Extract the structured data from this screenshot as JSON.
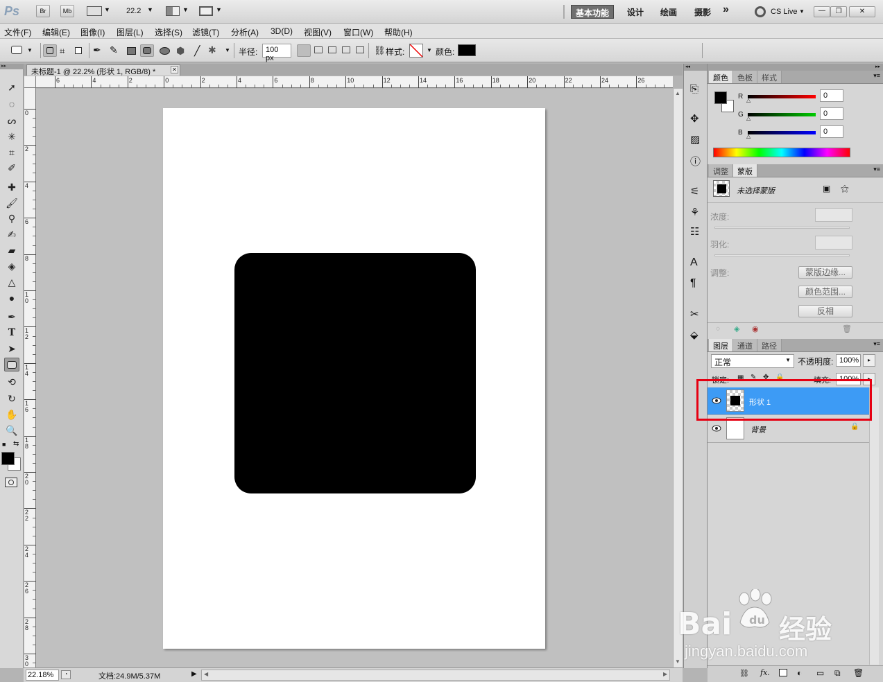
{
  "appbar": {
    "logo": "Ps",
    "br": "Br",
    "mb": "Mb",
    "zoom": "22.2",
    "workspaces": [
      "基本功能",
      "设计",
      "绘画",
      "摄影"
    ],
    "more": "»",
    "cslive": "CS Live",
    "min": "—",
    "restore": "❐",
    "close": "✕"
  },
  "menu": [
    "文件(F)",
    "编辑(E)",
    "图像(I)",
    "图层(L)",
    "选择(S)",
    "滤镜(T)",
    "分析(A)",
    "3D(D)",
    "视图(V)",
    "窗口(W)",
    "帮助(H)"
  ],
  "options": {
    "radius_label": "半径:",
    "radius_value": "100 px",
    "style_label": "样式:",
    "color_label": "颜色:",
    "color_value": "#000000"
  },
  "document": {
    "tab_title": "未标题-1 @ 22.2% (形状 1, RGB/8) *",
    "shape_color": "#000000",
    "hruler_ticks": [
      "6",
      "4",
      "2",
      "0",
      "2",
      "4",
      "6",
      "8",
      "10",
      "12",
      "14",
      "16",
      "18",
      "20",
      "22",
      "24",
      "26"
    ],
    "vruler_ticks": [
      "0",
      "2",
      "4",
      "6",
      "8",
      "10",
      "12",
      "14",
      "16",
      "18",
      "20",
      "22",
      "24",
      "26",
      "28",
      "30"
    ]
  },
  "status": {
    "zoom": "22.18%",
    "doc": "文档:24.9M/5.37M"
  },
  "color_panel": {
    "tabs": [
      "颜色",
      "色板",
      "样式"
    ],
    "channels": [
      {
        "name": "R",
        "value": "0"
      },
      {
        "name": "G",
        "value": "0"
      },
      {
        "name": "B",
        "value": "0"
      }
    ],
    "fg": "#000000",
    "bg": "#ffffff"
  },
  "mask_panel": {
    "tabs": [
      "调整",
      "蒙版"
    ],
    "title": "未选择蒙版",
    "density": "浓度:",
    "feather": "羽化:",
    "adjust": "调整:",
    "buttons": [
      "蒙版边缘...",
      "颜色范围...",
      "反相"
    ]
  },
  "layers_panel": {
    "tabs": [
      "图层",
      "通道",
      "路径"
    ],
    "blend_mode": "正常",
    "opacity_label": "不透明度:",
    "opacity_value": "100%",
    "lock_label": "锁定:",
    "fill_label": "填充:",
    "fill_value": "100%",
    "layers": [
      {
        "name": "形状 1",
        "selected": true
      },
      {
        "name": "背景",
        "selected": false
      }
    ],
    "bottom_icons": [
      "link-icon",
      "fx-icon",
      "mask-icon",
      "adjustment-icon",
      "folder-icon",
      "new-layer-icon",
      "trash-icon"
    ]
  },
  "watermark": {
    "brand": "Bai",
    "brand_cn": "经验",
    "url": "jingyan.baidu.com"
  }
}
